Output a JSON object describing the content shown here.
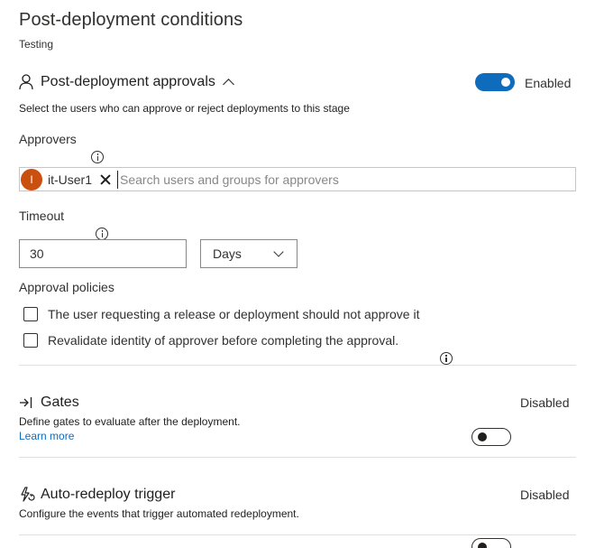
{
  "header": {
    "title": "Post-deployment conditions",
    "subtitle": "Testing"
  },
  "approvals": {
    "title": "Post-deployment approvals",
    "toggle_label": "Enabled",
    "description": "Select the users who can approve or reject deployments to this stage",
    "approvers_label": "Approvers",
    "approver": {
      "initial": "I",
      "name": "it-User1"
    },
    "search_placeholder": "Search users and groups for approvers",
    "timeout_label": "Timeout",
    "timeout_value": "30",
    "timeout_unit": "Days",
    "policies_label": "Approval policies",
    "policies": [
      "The user requesting a release or deployment should not approve it",
      "Revalidate identity of approver before completing the approval."
    ]
  },
  "gates": {
    "title": "Gates",
    "toggle_label": "Disabled",
    "description": "Define gates to evaluate after the deployment.",
    "link": "Learn more"
  },
  "redeploy": {
    "title": "Auto-redeploy trigger",
    "toggle_label": "Disabled",
    "description": "Configure the events that trigger automated redeployment."
  },
  "colors": {
    "accent": "#0f6cbd",
    "avatar": "#ca5010"
  }
}
